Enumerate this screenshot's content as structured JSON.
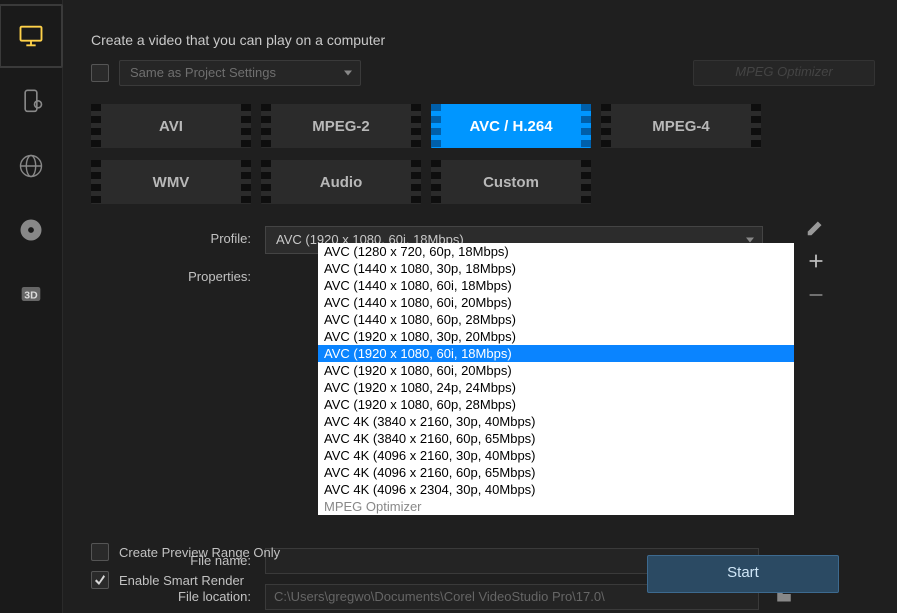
{
  "heading": "Create a video that you can play on a computer",
  "sameAsProject": {
    "label": "Same as Project Settings"
  },
  "mpegOptimizerButton": "MPEG Optimizer",
  "formats": [
    "AVI",
    "MPEG-2",
    "AVC / H.264",
    "MPEG-4",
    "WMV",
    "Audio",
    "Custom"
  ],
  "selectedFormatIndex": 2,
  "profile": {
    "label": "Profile:",
    "selected": "AVC (1920 x 1080, 60i, 18Mbps)",
    "options": [
      "AVC (1280 x 720, 60p, 18Mbps)",
      "AVC (1440 x 1080, 30p, 18Mbps)",
      "AVC (1440 x 1080, 60i, 18Mbps)",
      "AVC (1440 x 1080, 60i, 20Mbps)",
      "AVC (1440 x 1080, 60p, 28Mbps)",
      "AVC (1920 x 1080, 30p, 20Mbps)",
      "AVC (1920 x 1080, 60i, 18Mbps)",
      "AVC (1920 x 1080, 60i, 20Mbps)",
      "AVC (1920 x 1080, 24p, 24Mbps)",
      "AVC (1920 x 1080, 60p, 28Mbps)",
      "AVC 4K (3840 x 2160, 30p, 40Mbps)",
      "AVC 4K (3840 x 2160, 60p, 65Mbps)",
      "AVC 4K (4096 x 2160, 30p, 40Mbps)",
      "AVC 4K (4096 x 2160, 60p, 65Mbps)",
      "AVC 4K (4096 x 2304, 30p, 40Mbps)",
      "MPEG Optimizer"
    ],
    "highlightIndex": 6,
    "dimIndex": 15
  },
  "propertiesLabel": "Properties:",
  "fileNameLabel": "File name:",
  "fileLocationLabel": "File location:",
  "fileLocationValue": "C:\\Users\\gregwo\\Documents\\Corel VideoStudio Pro\\17.0\\",
  "createPreviewLabel": "Create Preview Range Only",
  "smartRenderLabel": "Enable Smart Render",
  "startLabel": "Start"
}
